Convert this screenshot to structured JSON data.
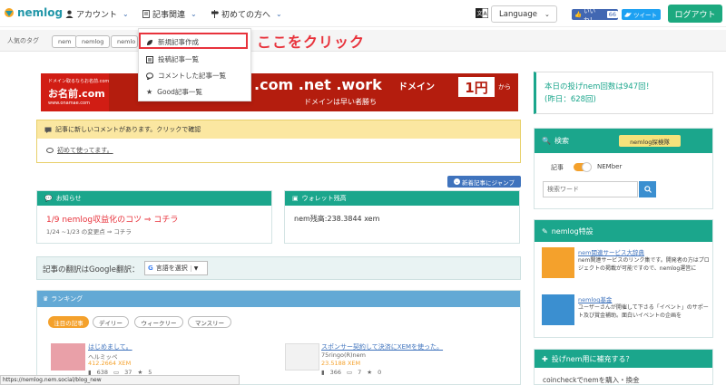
{
  "nav": {
    "logo_text": "nemlog",
    "account": "アカウント",
    "articles": "記事関連",
    "beginners": "初めての方へ",
    "language": "Language",
    "fb_like": "いいね！",
    "fb_count": "66",
    "tweet": "ツイート",
    "logout": "ログアウト"
  },
  "tags": {
    "label": "人気のタグ",
    "items": [
      "nem",
      "nemlog",
      "nemlo"
    ]
  },
  "dropdown": {
    "items": [
      "新規記事作成",
      "投稿記事一覧",
      "コメントした記事一覧",
      "Good記事一覧"
    ]
  },
  "callout": "ここをクリック",
  "banner": {
    "left_small": "ドメイン取るならお名前.com",
    "left_brand": "お名前.com",
    "left_url": "www.onamae.com",
    "domains": ".com .net .work",
    "domain_word": "ドメイン",
    "price": "1円",
    "price_suffix": "から",
    "tagline": "ドメインは早い者勝ち"
  },
  "notice": {
    "head": "記事に新しいコメントがあります。クリックで確認",
    "link": "初めて使ってます。"
  },
  "jump_label": "新着記事にジャンプ",
  "info_card": {
    "title": "お知らせ",
    "headline": "1/9 nemlog収益化のコツ ⇒ コチラ",
    "date_line": "1/24  ~1/23 の変更点  ⇒  コチラ"
  },
  "wallet_card": {
    "title": "ウォレット残高",
    "balance": "nem残高:238.3844 xem"
  },
  "translate": {
    "label": "記事の翻訳はGoogle翻訳：",
    "select": "言語を選択"
  },
  "ranking": {
    "title": "ランキング",
    "tabs": [
      "注目の記事",
      "デイリー",
      "ウィークリー",
      "マンスリー"
    ],
    "entries": [
      {
        "title": "はじめまして。",
        "author": "ヘルミッペ",
        "xem": "412.2664 XEM",
        "views": "638",
        "comments": "37",
        "goods": "5"
      },
      {
        "title": "スポンサー契約して決済にXEMを使った。",
        "author": "75ringo(R)nem",
        "xem": "23.5188 XEM",
        "views": "366",
        "comments": "7",
        "goods": "0"
      }
    ]
  },
  "right": {
    "tip_count": "本日の投げnem回数は947回！",
    "tip_yesterday": "(昨日：628回)",
    "search_title": "検索",
    "search_btn": "nemlog探検隊",
    "toggle_left": "記事",
    "toggle_right": "NEMber",
    "search_placeholder": "検索ワード",
    "feature_title": "nemlog特設",
    "feature1_title": "nem関連サービス大辞典",
    "feature1_text": "nem関連サービスのリンク集です。開発者の方はプロジェクトの掲載が可能ですので、nemlog運営に",
    "feature2_title": "nemlog基金",
    "feature2_text": "ユーザーさんが開催して下さる「イベント」のサポート及び賞金補助。面白いイベントの企画を",
    "refill_title": "投げnem用に補充する？",
    "refill_text": "coincheckでnemを購入・換金"
  },
  "status_url": "https://nemlog.nem.social/blog_new",
  "colors": {
    "accent": "#1ba68c",
    "red": "#e8333c",
    "blue": "#3f73bd"
  }
}
